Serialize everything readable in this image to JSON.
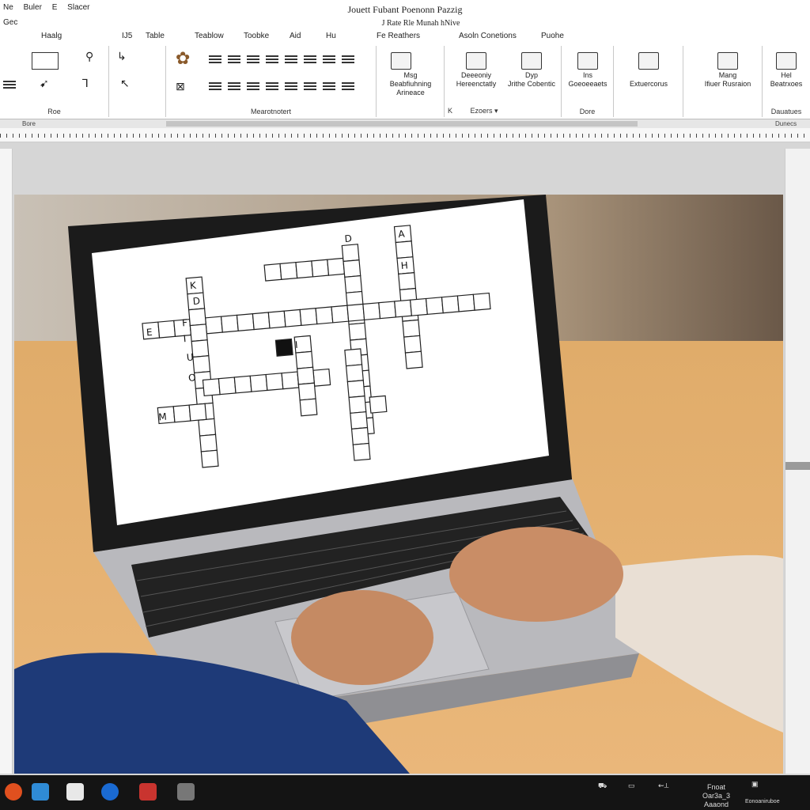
{
  "menu": {
    "items": [
      "Ne",
      "Buler",
      "E",
      "Slacer"
    ],
    "row2": "Gec"
  },
  "title": {
    "main": "Jouett Fubant Poenonn Pazzig",
    "sub": "J Rate Rle Munah hNive"
  },
  "tabs": [
    {
      "label": "Haalg"
    },
    {
      "label": "IJ5"
    },
    {
      "label": "Table"
    },
    {
      "label": "Teablow"
    },
    {
      "label": "Toobke"
    },
    {
      "label": "Aid"
    },
    {
      "label": "Hu"
    },
    {
      "label": "Fe Reathers"
    },
    {
      "label": "Asoln Conetions"
    },
    {
      "label": "Puohe"
    }
  ],
  "ribbon": {
    "group1_label": "Roe",
    "group3_label": "Mearotnotert",
    "btn_msg_line1": "Msg",
    "btn_msg_line2": "Beabfiuhning",
    "btn_msg_line3": "Arineace",
    "btn_dec_line1": "Deeeoniy",
    "btn_dec_line2": "Hereenctatly",
    "btn_dyp": "Dyp",
    "btn_dyp_sub": "Jrithe Cobentic",
    "footer_k": "K",
    "footer_ezoers": "Ezoers",
    "btn_ins": "Ins",
    "btn_ins_sub": "Goeoeeaets",
    "group_done": "Dore",
    "btn_ext": "Extuercorus",
    "btn_mang_line1": "Mang",
    "btn_mang_line2": "Ifiuer Rusraion",
    "btn_hel_line1": "Hel",
    "btn_hel_line2": "Beatrxoes",
    "group_last": "Dauatues"
  },
  "statusbar": {
    "left": "Bore",
    "right": "Dunecs"
  },
  "crossword": {
    "letters": [
      "D",
      "A",
      "K",
      "D",
      "H",
      "E",
      "F",
      "I",
      "U",
      "O",
      "I",
      "M"
    ]
  },
  "taskbar": {
    "clock_line1": "Oar3a_3",
    "clock_line2": "Aaaond",
    "clock_top": "Fnoat",
    "tray_bottom": "Eonoaniruboe"
  }
}
